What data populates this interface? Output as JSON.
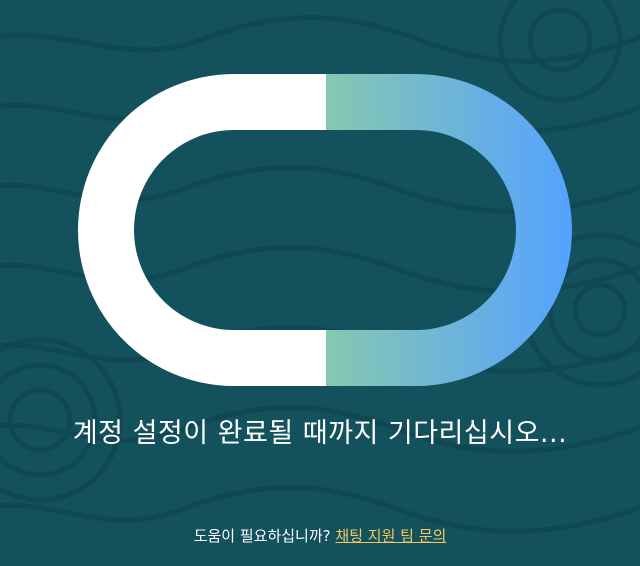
{
  "colors": {
    "background": "#13515c",
    "loader_left": "#ffffff",
    "loader_gradient_start": "#86c8b0",
    "loader_gradient_end": "#55a2ff",
    "link": "#f3c768"
  },
  "loader": {
    "icon": "loading-ring-icon"
  },
  "message": "계정 설정이 완료될 때까지 기다리십시오...",
  "help": {
    "prompt": "도움이 필요하십니까?",
    "link_label": "채팅 지원 팀 문의"
  }
}
